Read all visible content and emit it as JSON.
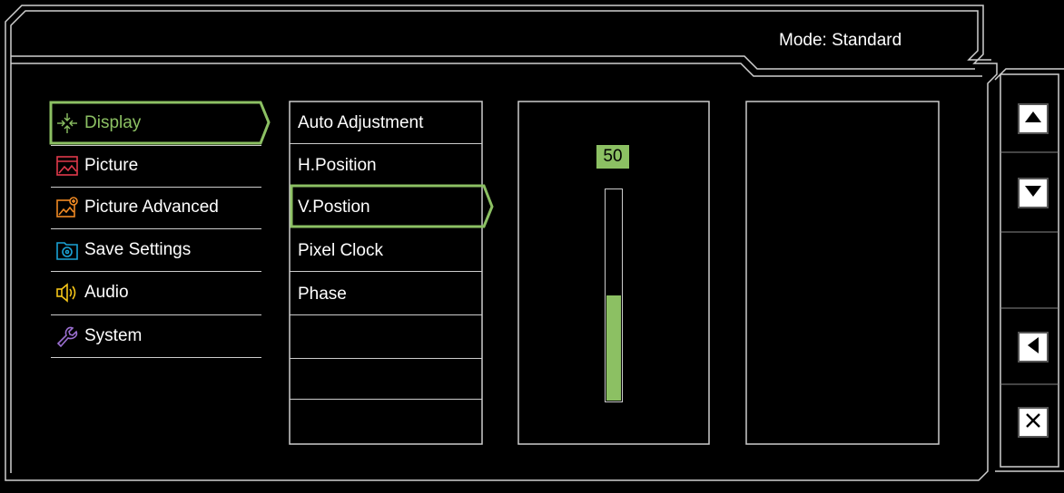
{
  "header": {
    "mode_label": "Mode: Standard"
  },
  "main_menu": {
    "items": [
      {
        "label": "Display",
        "icon": "display-icon",
        "selected": true
      },
      {
        "label": "Picture",
        "icon": "picture-icon"
      },
      {
        "label": "Picture Advanced",
        "icon": "picture-advanced-icon"
      },
      {
        "label": "Save Settings",
        "icon": "save-settings-icon"
      },
      {
        "label": "Audio",
        "icon": "audio-icon"
      },
      {
        "label": "System",
        "icon": "system-icon"
      }
    ]
  },
  "sub_menu": {
    "items": [
      {
        "label": "Auto Adjustment"
      },
      {
        "label": "H.Position"
      },
      {
        "label": "V.Postion",
        "selected": true
      },
      {
        "label": "Pixel Clock"
      },
      {
        "label": "Phase"
      }
    ]
  },
  "value_panel": {
    "value": "50",
    "level_fraction": 0.5
  },
  "side_buttons": [
    "up-arrow-icon",
    "down-arrow-icon",
    "left-arrow-icon",
    "close-icon"
  ],
  "colors": {
    "accent_green": "#8cc063",
    "frame": "#d0d0d0",
    "display_icon": "#8cc063",
    "picture_icon": "#e0394b",
    "picture_advanced_icon": "#f08a24",
    "save_settings_icon": "#1aa3d6",
    "audio_icon": "#f5c518",
    "system_icon": "#9b6fd1"
  }
}
